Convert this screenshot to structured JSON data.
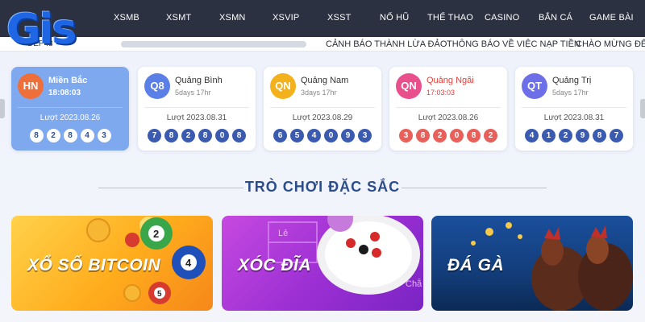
{
  "logo": {
    "text": "Gis"
  },
  "nav": {
    "items": [
      "XSMB",
      "XSMT",
      "XSMN",
      "XSVIP",
      "XSST",
      "NỔ HŨ",
      "THỂ THAO",
      "CASINO",
      "BẮN CÁ",
      "GAME BÀI"
    ]
  },
  "notice": {
    "tag": "DEP :8",
    "items": [
      "CẢNH BÁO THÀNH LỪA ĐẢO",
      "THÔNG BÁO VỀ VIỆC NẠP TIỀN",
      "CHÀO MỪNG ĐẾ"
    ]
  },
  "cards": [
    {
      "badge": "HN",
      "badge_color": "#ef6f3a",
      "name": "Miền Bắc",
      "sub": "18:08:03",
      "date": "Lượt 2023.08.26",
      "balls": [
        "8",
        "2",
        "8",
        "4",
        "3"
      ],
      "style": "active"
    },
    {
      "badge": "Q8",
      "badge_color": "#5a7fe6",
      "name": "Quảng Bình",
      "sub": "5days 17hr",
      "date": "Lượt 2023.08.31",
      "balls": [
        "7",
        "8",
        "2",
        "8",
        "0",
        "8"
      ],
      "style": "blue"
    },
    {
      "badge": "QN",
      "badge_color": "#f3b21c",
      "name": "Quảng Nam",
      "sub": "3days 17hr",
      "date": "Lượt 2023.08.29",
      "balls": [
        "6",
        "5",
        "4",
        "0",
        "9",
        "3"
      ],
      "style": "blue"
    },
    {
      "badge": "QN",
      "badge_color": "#e94f8c",
      "name": "Quảng Ngãi",
      "sub": "17:03:03",
      "date": "Lượt 2023.08.26",
      "balls": [
        "3",
        "8",
        "2",
        "0",
        "8",
        "2"
      ],
      "style": "red"
    },
    {
      "badge": "QT",
      "badge_color": "#6d6fe8",
      "name": "Quảng Trị",
      "sub": "5days 17hr",
      "date": "Lượt 2023.08.31",
      "balls": [
        "4",
        "1",
        "2",
        "9",
        "8",
        "7"
      ],
      "style": "blue"
    }
  ],
  "section": {
    "title": "TRÒ CHƠI ĐẶC SẮC"
  },
  "games": [
    {
      "label": "XỔ SỐ BITCOIN",
      "icon": "lottery-balls"
    },
    {
      "label": "XÓC ĐĨA",
      "icon": "dice-plate"
    },
    {
      "label": "ĐÁ GÀ",
      "icon": "roosters"
    }
  ],
  "colors": {
    "nav_bg": "#2b3140",
    "accent": "#2d4c8b",
    "active_card": "#7fa9ef",
    "ball_blue": "#3b5bb0",
    "ball_red": "#e9605b"
  }
}
